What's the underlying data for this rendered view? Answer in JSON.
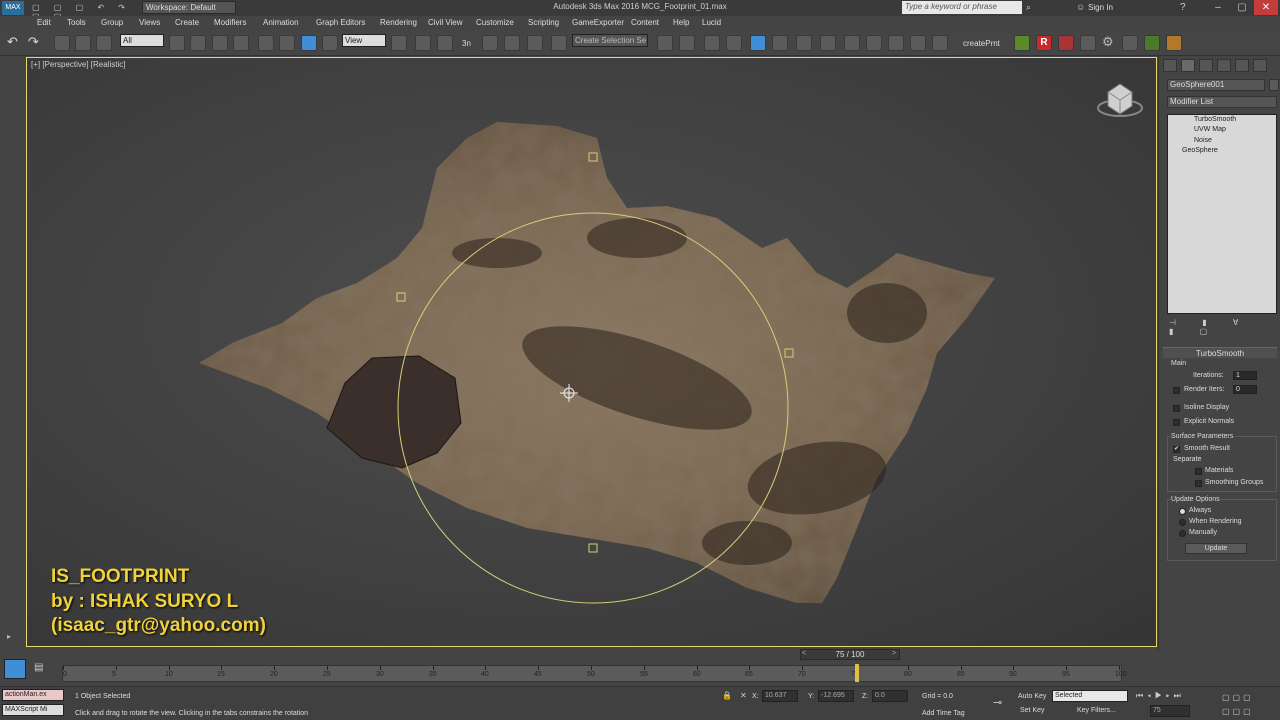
{
  "window": {
    "title": "Autodesk 3ds Max 2016     MCG_Footprint_01.max",
    "workspace": "Workspace: Default",
    "search_placeholder": "Type a keyword or phrase",
    "sign_in": "Sign In",
    "help_glyph": "?"
  },
  "menu": [
    "Edit",
    "Tools",
    "Group",
    "Views",
    "Create",
    "Modifiers",
    "Animation",
    "Graph Editors",
    "Rendering",
    "Civil View",
    "Customize",
    "Scripting",
    "GameExporter",
    "Content",
    "Help",
    "Lucid"
  ],
  "toolbar": {
    "filter_value": "All",
    "coord_value": "View",
    "selection_set_placeholder": "Create Selection Se",
    "script_label": "createPrnt",
    "snap_label": "3n"
  },
  "viewport": {
    "label": "[+] [Perspective] [Realistic]"
  },
  "overlay": {
    "line1": "IS_FOOTPRINT",
    "line2": "by : ISHAK SURYO L",
    "line3": "(isaac_gtr@yahoo.com)"
  },
  "command_panel": {
    "object_name": "GeoSphere001",
    "modifier_list": "Modifier List",
    "stack": [
      "TurboSmooth",
      "UVW Map",
      "Noise",
      "GeoSphere"
    ],
    "rollout_title": "TurboSmooth",
    "main_label": "Main",
    "iterations_label": "Iterations:",
    "iterations_value": "1",
    "render_iters_label": "Render Iters:",
    "render_iters_value": "0",
    "isoline_label": "Isoline Display",
    "explicit_normals_label": "Explicit Normals",
    "surface_params_label": "Surface Parameters",
    "smooth_result_label": "Smooth Result",
    "separate_label": "Separate",
    "materials_label": "Materials",
    "smoothing_groups_label": "Smoothing Groups",
    "update_options_label": "Update Options",
    "always_label": "Always",
    "when_rendering_label": "When Rendering",
    "manually_label": "Manually",
    "update_button": "Update"
  },
  "timeline": {
    "slider_text": "75 / 100",
    "current_frame": 75,
    "total_frames": 100,
    "ticks": [
      "0",
      "5",
      "10",
      "15",
      "20",
      "25",
      "30",
      "35",
      "40",
      "45",
      "50",
      "55",
      "60",
      "65",
      "70",
      "75",
      "80",
      "85",
      "90",
      "95",
      "100"
    ]
  },
  "status": {
    "maxscript_label": "actionMan.ex",
    "maxscript_sub": "MAXScript Mi",
    "selection": "1 Object Selected",
    "prompt": "Click and drag to rotate the view.  Clicking in the tabs constrains the rotation",
    "x_label": "X:",
    "x_value": "10.637",
    "y_label": "Y:",
    "y_value": "-12.695",
    "z_label": "Z:",
    "z_value": "0.0",
    "grid": "Grid = 0.0",
    "add_time_tag": "Add Time Tag",
    "auto_key": "Auto Key",
    "selected": "Selected",
    "set_key": "Set Key",
    "key_filters": "Key Filters...",
    "frame_value": "75"
  },
  "colors": {
    "accent": "#3f8fd8",
    "overlay_text": "#f0d23a",
    "viewport_border": "#e8d76a"
  }
}
